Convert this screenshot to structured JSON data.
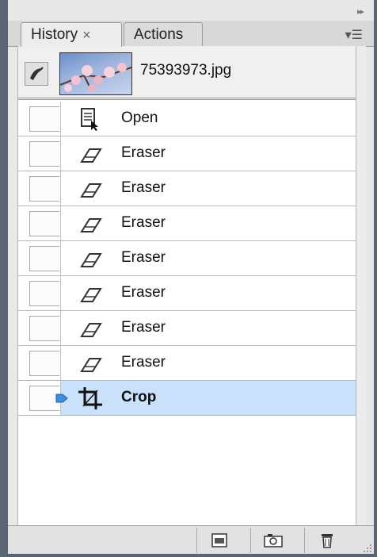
{
  "tabs": [
    {
      "label": "History",
      "close": "×",
      "active": true
    },
    {
      "label": "Actions",
      "active": false
    }
  ],
  "panel_menu_icon": "panel-menu-icon",
  "snapshot": {
    "name": "75393973.jpg"
  },
  "history": [
    {
      "label": "Open",
      "icon": "open-document-icon",
      "selected": false
    },
    {
      "label": "Eraser",
      "icon": "eraser-icon",
      "selected": false
    },
    {
      "label": "Eraser",
      "icon": "eraser-icon",
      "selected": false
    },
    {
      "label": "Eraser",
      "icon": "eraser-icon",
      "selected": false
    },
    {
      "label": "Eraser",
      "icon": "eraser-icon",
      "selected": false
    },
    {
      "label": "Eraser",
      "icon": "eraser-icon",
      "selected": false
    },
    {
      "label": "Eraser",
      "icon": "eraser-icon",
      "selected": false
    },
    {
      "label": "Eraser",
      "icon": "eraser-icon",
      "selected": false
    },
    {
      "label": "Crop",
      "icon": "crop-icon",
      "selected": true
    }
  ],
  "footer_buttons": [
    "new-document-from-state-icon",
    "new-snapshot-icon",
    "trash-icon"
  ],
  "colors": {
    "selected_row": "#c9e1fb",
    "state_arrow": "#3a8fe0"
  }
}
